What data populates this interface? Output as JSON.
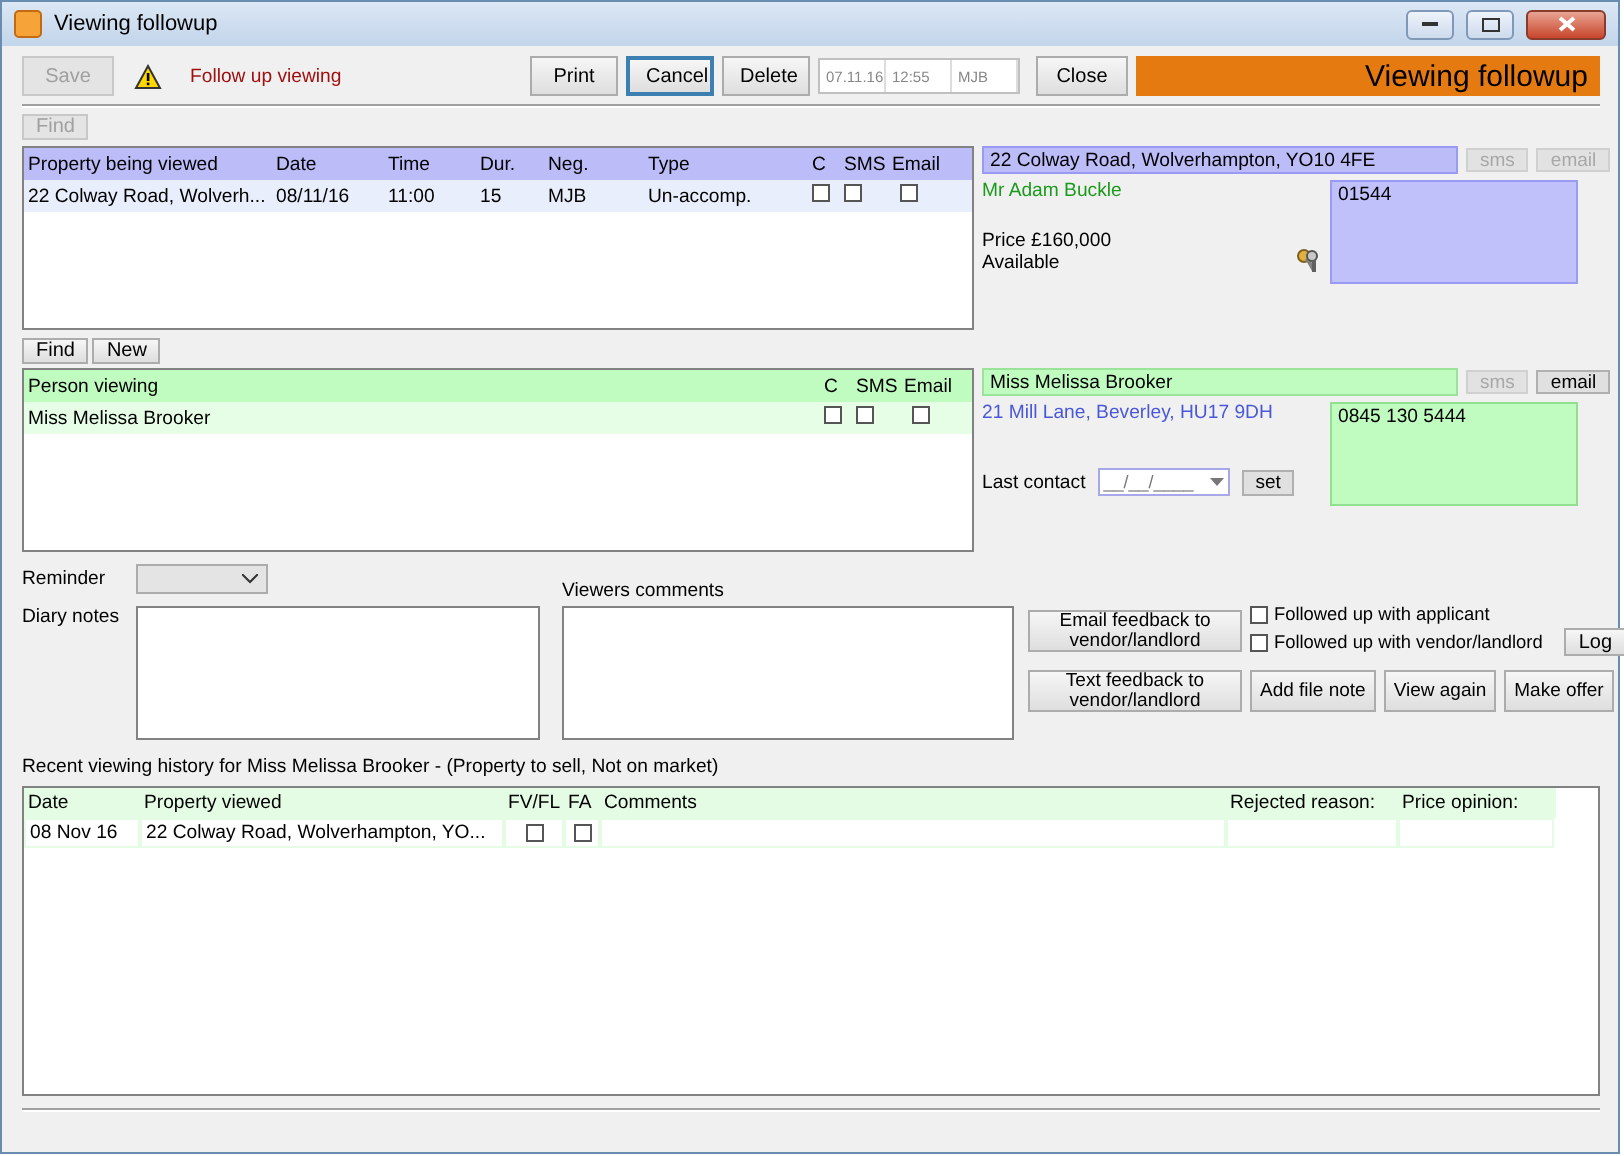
{
  "window": {
    "title": "Viewing followup"
  },
  "toolbar": {
    "save": {
      "label": "Save",
      "disabled": true
    },
    "status": "Follow up viewing",
    "buttons": [
      {
        "label": "Print",
        "focused": false
      },
      {
        "label": "Cancel",
        "focused": true
      },
      {
        "label": "Delete",
        "focused": false
      }
    ],
    "stamp_fields": [
      "07.11.16",
      "12:55",
      "MJB"
    ],
    "close": "Close",
    "banner": "Viewing followup"
  },
  "property_section": {
    "find": {
      "label": "Find",
      "disabled": true
    },
    "columns": [
      "Property being viewed",
      "Date",
      "Time",
      "Dur.",
      "Neg.",
      "Type",
      "C",
      "SMS",
      "Email"
    ],
    "rows": [
      {
        "cells": [
          "22 Colway Road, Wolverh...",
          "08/11/16",
          "11:00",
          "15",
          "MJB",
          "Un-accomp."
        ],
        "c": false,
        "sms": false,
        "email": false
      }
    ],
    "detail": {
      "address": "22 Colway Road, Wolverhampton, YO10 4FE",
      "sms": {
        "label": "sms",
        "disabled": true
      },
      "email": {
        "label": "email",
        "disabled": true
      },
      "contact": "Mr Adam Buckle",
      "price": "Price £160,000",
      "status": "Available",
      "phone": "01544"
    }
  },
  "person_section": {
    "find": {
      "label": "Find",
      "disabled": false
    },
    "new": "New",
    "columns": [
      "Person viewing",
      "C",
      "SMS",
      "Email"
    ],
    "rows": [
      {
        "cells": [
          "Miss Melissa Brooker"
        ],
        "c": false,
        "sms": false,
        "email": false
      }
    ],
    "detail": {
      "name": "Miss Melissa Brooker",
      "sms": {
        "label": "sms",
        "disabled": true
      },
      "email": {
        "label": "email",
        "disabled": false
      },
      "address": "21 Mill Lane, Beverley, HU17 9DH",
      "last_contact_label": "Last contact",
      "last_contact_placeholder": "__/__/____",
      "set": "set",
      "phone": "0845 130 5444"
    }
  },
  "followup": {
    "reminder_label": "Reminder",
    "diary_label": "Diary notes",
    "comments_label": "Viewers comments",
    "email_feedback": "Email feedback to vendor/landlord",
    "text_feedback": "Text feedback to vendor/landlord",
    "checks": [
      {
        "label": "Followed up with applicant",
        "checked": false
      },
      {
        "label": "Followed up with vendor/landlord",
        "checked": false
      }
    ],
    "log": "Log",
    "actions": [
      "Add file note",
      "View again",
      "Make offer"
    ]
  },
  "history": {
    "title": "Recent viewing history for  Miss Melissa Brooker - (Property to sell, Not on market)",
    "columns": [
      "Date",
      "Property viewed",
      "FV/FL",
      "FA",
      "Comments",
      "Rejected reason:",
      "Price opinion:"
    ],
    "rows": [
      {
        "date": "08 Nov 16",
        "property": "22 Colway Road, Wolverhampton, YO...",
        "fv_fl": false,
        "fa": false
      }
    ]
  }
}
